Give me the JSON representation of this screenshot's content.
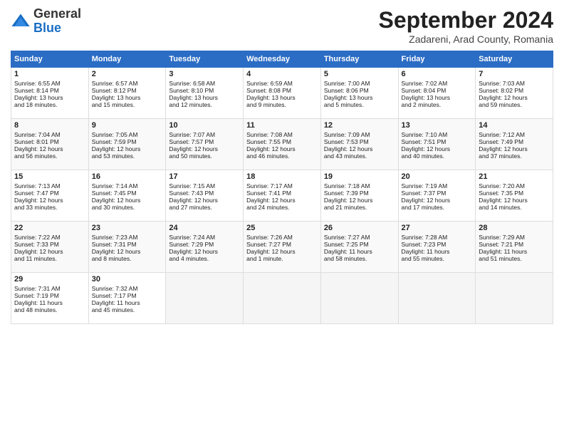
{
  "logo": {
    "general": "General",
    "blue": "Blue"
  },
  "title": "September 2024",
  "location": "Zadareni, Arad County, Romania",
  "days_header": [
    "Sunday",
    "Monday",
    "Tuesday",
    "Wednesday",
    "Thursday",
    "Friday",
    "Saturday"
  ],
  "weeks": [
    [
      {
        "day": "1",
        "lines": [
          "Sunrise: 6:55 AM",
          "Sunset: 8:14 PM",
          "Daylight: 13 hours",
          "and 18 minutes."
        ]
      },
      {
        "day": "2",
        "lines": [
          "Sunrise: 6:57 AM",
          "Sunset: 8:12 PM",
          "Daylight: 13 hours",
          "and 15 minutes."
        ]
      },
      {
        "day": "3",
        "lines": [
          "Sunrise: 6:58 AM",
          "Sunset: 8:10 PM",
          "Daylight: 13 hours",
          "and 12 minutes."
        ]
      },
      {
        "day": "4",
        "lines": [
          "Sunrise: 6:59 AM",
          "Sunset: 8:08 PM",
          "Daylight: 13 hours",
          "and 9 minutes."
        ]
      },
      {
        "day": "5",
        "lines": [
          "Sunrise: 7:00 AM",
          "Sunset: 8:06 PM",
          "Daylight: 13 hours",
          "and 5 minutes."
        ]
      },
      {
        "day": "6",
        "lines": [
          "Sunrise: 7:02 AM",
          "Sunset: 8:04 PM",
          "Daylight: 13 hours",
          "and 2 minutes."
        ]
      },
      {
        "day": "7",
        "lines": [
          "Sunrise: 7:03 AM",
          "Sunset: 8:02 PM",
          "Daylight: 12 hours",
          "and 59 minutes."
        ]
      }
    ],
    [
      {
        "day": "8",
        "lines": [
          "Sunrise: 7:04 AM",
          "Sunset: 8:01 PM",
          "Daylight: 12 hours",
          "and 56 minutes."
        ]
      },
      {
        "day": "9",
        "lines": [
          "Sunrise: 7:05 AM",
          "Sunset: 7:59 PM",
          "Daylight: 12 hours",
          "and 53 minutes."
        ]
      },
      {
        "day": "10",
        "lines": [
          "Sunrise: 7:07 AM",
          "Sunset: 7:57 PM",
          "Daylight: 12 hours",
          "and 50 minutes."
        ]
      },
      {
        "day": "11",
        "lines": [
          "Sunrise: 7:08 AM",
          "Sunset: 7:55 PM",
          "Daylight: 12 hours",
          "and 46 minutes."
        ]
      },
      {
        "day": "12",
        "lines": [
          "Sunrise: 7:09 AM",
          "Sunset: 7:53 PM",
          "Daylight: 12 hours",
          "and 43 minutes."
        ]
      },
      {
        "day": "13",
        "lines": [
          "Sunrise: 7:10 AM",
          "Sunset: 7:51 PM",
          "Daylight: 12 hours",
          "and 40 minutes."
        ]
      },
      {
        "day": "14",
        "lines": [
          "Sunrise: 7:12 AM",
          "Sunset: 7:49 PM",
          "Daylight: 12 hours",
          "and 37 minutes."
        ]
      }
    ],
    [
      {
        "day": "15",
        "lines": [
          "Sunrise: 7:13 AM",
          "Sunset: 7:47 PM",
          "Daylight: 12 hours",
          "and 33 minutes."
        ]
      },
      {
        "day": "16",
        "lines": [
          "Sunrise: 7:14 AM",
          "Sunset: 7:45 PM",
          "Daylight: 12 hours",
          "and 30 minutes."
        ]
      },
      {
        "day": "17",
        "lines": [
          "Sunrise: 7:15 AM",
          "Sunset: 7:43 PM",
          "Daylight: 12 hours",
          "and 27 minutes."
        ]
      },
      {
        "day": "18",
        "lines": [
          "Sunrise: 7:17 AM",
          "Sunset: 7:41 PM",
          "Daylight: 12 hours",
          "and 24 minutes."
        ]
      },
      {
        "day": "19",
        "lines": [
          "Sunrise: 7:18 AM",
          "Sunset: 7:39 PM",
          "Daylight: 12 hours",
          "and 21 minutes."
        ]
      },
      {
        "day": "20",
        "lines": [
          "Sunrise: 7:19 AM",
          "Sunset: 7:37 PM",
          "Daylight: 12 hours",
          "and 17 minutes."
        ]
      },
      {
        "day": "21",
        "lines": [
          "Sunrise: 7:20 AM",
          "Sunset: 7:35 PM",
          "Daylight: 12 hours",
          "and 14 minutes."
        ]
      }
    ],
    [
      {
        "day": "22",
        "lines": [
          "Sunrise: 7:22 AM",
          "Sunset: 7:33 PM",
          "Daylight: 12 hours",
          "and 11 minutes."
        ]
      },
      {
        "day": "23",
        "lines": [
          "Sunrise: 7:23 AM",
          "Sunset: 7:31 PM",
          "Daylight: 12 hours",
          "and 8 minutes."
        ]
      },
      {
        "day": "24",
        "lines": [
          "Sunrise: 7:24 AM",
          "Sunset: 7:29 PM",
          "Daylight: 12 hours",
          "and 4 minutes."
        ]
      },
      {
        "day": "25",
        "lines": [
          "Sunrise: 7:26 AM",
          "Sunset: 7:27 PM",
          "Daylight: 12 hours",
          "and 1 minute."
        ]
      },
      {
        "day": "26",
        "lines": [
          "Sunrise: 7:27 AM",
          "Sunset: 7:25 PM",
          "Daylight: 11 hours",
          "and 58 minutes."
        ]
      },
      {
        "day": "27",
        "lines": [
          "Sunrise: 7:28 AM",
          "Sunset: 7:23 PM",
          "Daylight: 11 hours",
          "and 55 minutes."
        ]
      },
      {
        "day": "28",
        "lines": [
          "Sunrise: 7:29 AM",
          "Sunset: 7:21 PM",
          "Daylight: 11 hours",
          "and 51 minutes."
        ]
      }
    ],
    [
      {
        "day": "29",
        "lines": [
          "Sunrise: 7:31 AM",
          "Sunset: 7:19 PM",
          "Daylight: 11 hours",
          "and 48 minutes."
        ]
      },
      {
        "day": "30",
        "lines": [
          "Sunrise: 7:32 AM",
          "Sunset: 7:17 PM",
          "Daylight: 11 hours",
          "and 45 minutes."
        ]
      },
      {
        "day": "",
        "lines": []
      },
      {
        "day": "",
        "lines": []
      },
      {
        "day": "",
        "lines": []
      },
      {
        "day": "",
        "lines": []
      },
      {
        "day": "",
        "lines": []
      }
    ]
  ]
}
